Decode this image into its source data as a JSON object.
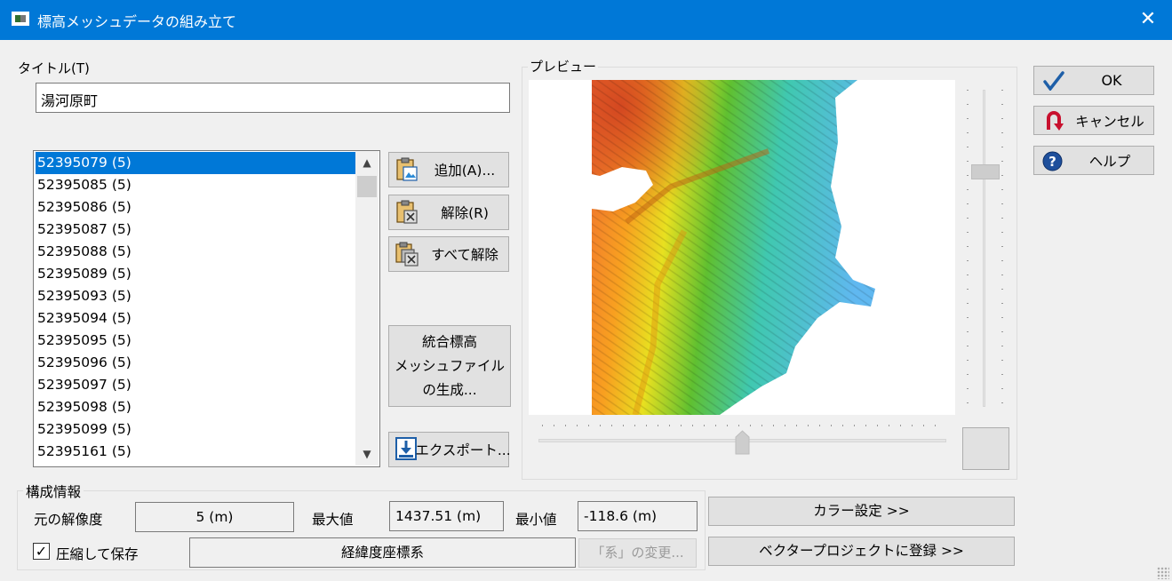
{
  "window": {
    "title": "標高メッシュデータの組み立て",
    "close_glyph": "✕"
  },
  "title_field": {
    "label": "タイトル(T)",
    "value": "湯河原町"
  },
  "mesh_list": {
    "items": [
      "52395079 (5)",
      "52395085 (5)",
      "52395086 (5)",
      "52395087 (5)",
      "52395088 (5)",
      "52395089 (5)",
      "52395093 (5)",
      "52395094 (5)",
      "52395095 (5)",
      "52395096 (5)",
      "52395097 (5)",
      "52395098 (5)",
      "52395099 (5)",
      "52395161 (5)"
    ],
    "selected_index": 0
  },
  "list_buttons": {
    "add": "追加(A)...",
    "remove": "解除(R)",
    "remove_all": "すべて解除",
    "generate": [
      "統合標高",
      "メッシュファイル",
      "の生成..."
    ],
    "export": "エクスポート..."
  },
  "preview": {
    "label": "プレビュー"
  },
  "dialog_buttons": {
    "ok": "OK",
    "cancel": "キャンセル",
    "help": "ヘルプ"
  },
  "info": {
    "group_label": "構成情報",
    "resolution_label": "元の解像度",
    "resolution_value": "5 (m)",
    "max_label": "最大値",
    "max_value": "1437.51 (m)",
    "min_label": "最小値",
    "min_value": "-118.6 (m)",
    "compress_label": "圧縮して保存",
    "compress_checked": true,
    "coordinate_system": "経緯度座標系",
    "change_system_button": "「系」の変更..."
  },
  "actions": {
    "color_settings": "カラー設定 >>",
    "register_vector_project": "ベクタープロジェクトに登録 >>"
  },
  "colors": {
    "titlebar": "#0078d7",
    "selection": "#0078d7",
    "button_face": "#e1e1e1",
    "window_bg": "#f0f0f0"
  }
}
